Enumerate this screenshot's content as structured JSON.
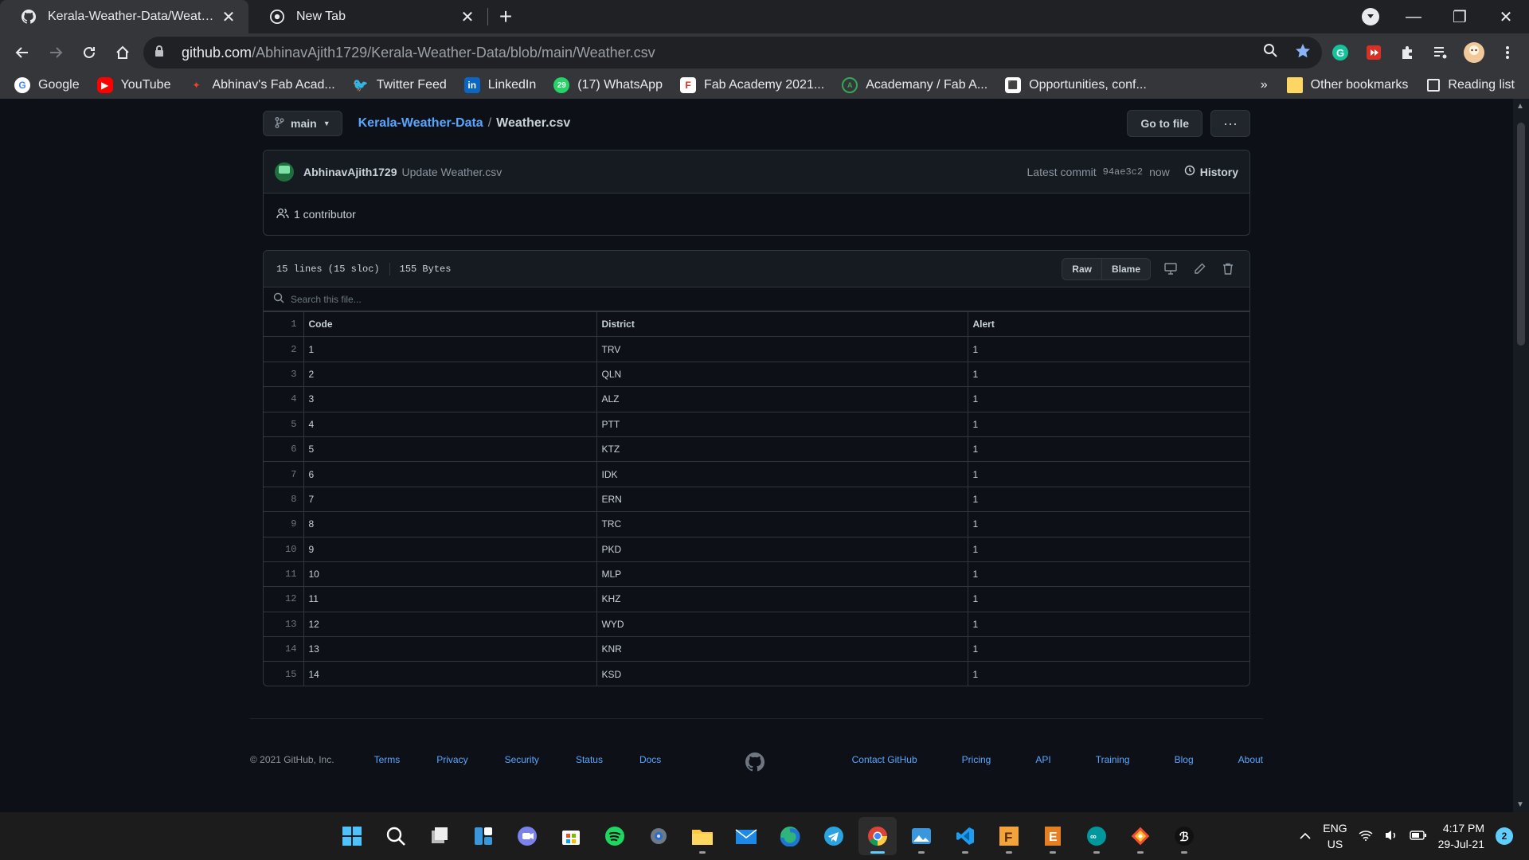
{
  "browser": {
    "tabs": [
      {
        "title": "Kerala-Weather-Data/Weather.csv",
        "active": true
      },
      {
        "title": "New Tab",
        "active": false
      }
    ],
    "url_host": "github.com",
    "url_path": "/AbhinavAjith1729/Kerala-Weather-Data/blob/main/Weather.csv",
    "bookmarks": [
      {
        "label": "Google",
        "icon": "google-icon"
      },
      {
        "label": "YouTube",
        "icon": "youtube-icon"
      },
      {
        "label": "Abhinav's Fab Acad...",
        "icon": "fab-academy-icon"
      },
      {
        "label": "Twitter Feed",
        "icon": "twitter-icon"
      },
      {
        "label": "LinkedIn",
        "icon": "linkedin-icon"
      },
      {
        "label": "(17) WhatsApp",
        "icon": "whatsapp-icon"
      },
      {
        "label": "Fab Academy 2021...",
        "icon": "fab-lab-icon"
      },
      {
        "label": "Academany / Fab A...",
        "icon": "academany-icon"
      },
      {
        "label": "Opportunities, conf...",
        "icon": "opportunities-icon"
      }
    ],
    "bookmarks_more": "»",
    "other_bookmarks": "Other bookmarks",
    "reading_list": "Reading list",
    "whatsapp_badge": "29"
  },
  "repo": {
    "branch": "main",
    "repo_name": "Kerala-Weather-Data",
    "separator": "/",
    "file_name": "Weather.csv",
    "goto_file": "Go to file",
    "more": "···"
  },
  "commit": {
    "author": "AbhinavAjith1729",
    "message": "Update Weather.csv",
    "latest_label": "Latest commit",
    "sha": "94ae3c2",
    "time": "now",
    "history": "History",
    "contributors": "1 contributor"
  },
  "file": {
    "lines": "15 lines (15 sloc)",
    "size": "155 Bytes",
    "raw": "Raw",
    "blame": "Blame",
    "search_placeholder": "Search this file...",
    "header": {
      "line": "1",
      "cols": [
        "Code",
        "District",
        "Alert"
      ]
    },
    "rows": [
      {
        "line": "2",
        "cells": [
          "1",
          "TRV",
          "1"
        ]
      },
      {
        "line": "3",
        "cells": [
          "2",
          "QLN",
          "1"
        ]
      },
      {
        "line": "4",
        "cells": [
          "3",
          "ALZ",
          "1"
        ]
      },
      {
        "line": "5",
        "cells": [
          "4",
          "PTT",
          "1"
        ]
      },
      {
        "line": "6",
        "cells": [
          "5",
          "KTZ",
          "1"
        ]
      },
      {
        "line": "7",
        "cells": [
          "6",
          "IDK",
          "1"
        ]
      },
      {
        "line": "8",
        "cells": [
          "7",
          "ERN",
          "1"
        ]
      },
      {
        "line": "9",
        "cells": [
          "8",
          "TRC",
          "1"
        ]
      },
      {
        "line": "10",
        "cells": [
          "9",
          "PKD",
          "1"
        ]
      },
      {
        "line": "11",
        "cells": [
          "10",
          "MLP",
          "1"
        ]
      },
      {
        "line": "12",
        "cells": [
          "11",
          "KHZ",
          "1"
        ]
      },
      {
        "line": "13",
        "cells": [
          "12",
          "WYD",
          "1"
        ]
      },
      {
        "line": "14",
        "cells": [
          "13",
          "KNR",
          "1"
        ]
      },
      {
        "line": "15",
        "cells": [
          "14",
          "KSD",
          "1"
        ]
      }
    ]
  },
  "footer": {
    "copyright": "© 2021 GitHub, Inc.",
    "left_links": [
      "Terms",
      "Privacy",
      "Security",
      "Status",
      "Docs"
    ],
    "right_links": [
      "Contact GitHub",
      "Pricing",
      "API",
      "Training",
      "Blog",
      "About"
    ]
  },
  "taskbar": {
    "apps": [
      "start-icon",
      "search-icon",
      "task-view-icon",
      "widgets-icon",
      "teams-chat-icon",
      "ms-store-icon",
      "spotify-icon",
      "settings-icon",
      "file-explorer-icon",
      "mail-icon",
      "edge-icon",
      "telegram-icon",
      "chrome-icon",
      "photos-icon",
      "vscode-icon",
      "fusion-icon",
      "eagle-icon",
      "arduino-icon",
      "git-icon",
      "python-icon"
    ],
    "lang_top": "ENG",
    "lang_bottom": "US",
    "time": "4:17 PM",
    "date": "29-Jul-21",
    "notifications": "2"
  },
  "colors": {
    "accent_link": "#58a6ff",
    "bg": "#0d1117",
    "border": "#30363d"
  }
}
